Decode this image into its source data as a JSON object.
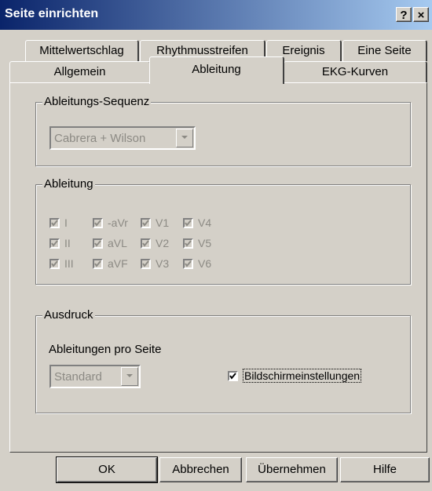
{
  "window": {
    "title": "Seite einrichten",
    "help_btn": "?",
    "close_btn": "×"
  },
  "tabs_back": [
    "Mittelwertschlag",
    "Rhythmusstreifen",
    "Ereignis",
    "Eine Seite"
  ],
  "tabs_front": [
    "Allgemein",
    "Ableitung",
    "EKG-Kurven"
  ],
  "active_tab": "Ableitung",
  "sequence": {
    "legend": "Ableitungs-Sequenz",
    "value": "Cabrera + Wilson"
  },
  "leads": {
    "legend": "Ableitung",
    "rows": [
      [
        "I",
        "-aVr",
        "V1",
        "V4"
      ],
      [
        "II",
        "aVL",
        "V2",
        "V5"
      ],
      [
        "III",
        "aVF",
        "V3",
        "V6"
      ]
    ]
  },
  "print": {
    "legend": "Ausdruck",
    "per_page_label": "Ableitungen pro Seite",
    "per_page_value": "Standard",
    "screen_settings": "Bildschirmeinstellungen",
    "screen_settings_checked": true
  },
  "buttons": {
    "ok": "OK",
    "cancel": "Abbrechen",
    "apply": "Übernehmen",
    "help": "Hilfe"
  }
}
